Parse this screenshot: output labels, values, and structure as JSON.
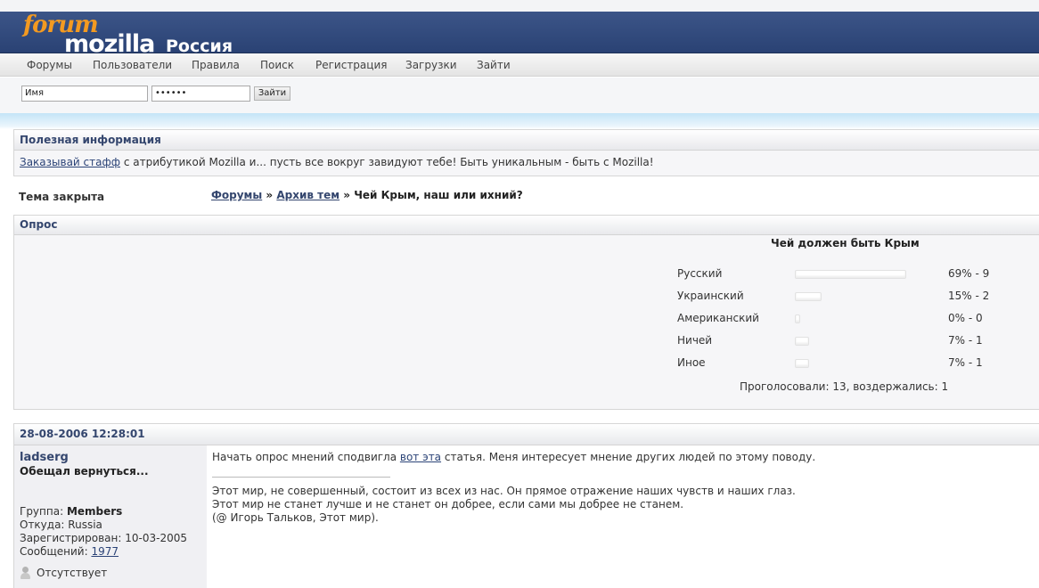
{
  "header": {
    "logo_forum": "forum",
    "logo_mozilla": "mozilla",
    "logo_country": "Россия"
  },
  "nav": {
    "items": [
      "Форумы",
      "Пользователи",
      "Правила",
      "Поиск",
      "Регистрация",
      "Загрузки",
      "Зайти"
    ]
  },
  "login": {
    "username_value": "Имя",
    "password_value": "••••••",
    "submit_label": "Зайти"
  },
  "info_block": {
    "title": "Полезная информация",
    "link_text": "Заказывай стафф",
    "text": " с атрибутикой Mozilla и... пусть все вокруг завидуют тебе! Быть уникальным - быть с Mozilla!"
  },
  "topic": {
    "status": "Тема закрыта",
    "breadcrumb": [
      "Форумы",
      "Архив тем",
      "Чей Крым, наш или ихний?"
    ],
    "separator": "»"
  },
  "poll": {
    "block_title": "Опрос",
    "question": "Чей должен быть Крым",
    "options": [
      {
        "label": "Русский",
        "percent": 69,
        "votes": 9,
        "text": "69% - 9"
      },
      {
        "label": "Украинский",
        "percent": 15,
        "votes": 2,
        "text": "15% - 2"
      },
      {
        "label": "Американский",
        "percent": 0,
        "votes": 0,
        "text": "0% - 0"
      },
      {
        "label": "Ничей",
        "percent": 7,
        "votes": 1,
        "text": "7% - 1"
      },
      {
        "label": "Иное",
        "percent": 7,
        "votes": 1,
        "text": "7% - 1"
      }
    ],
    "total": "Проголосовали: 13, воздержались: 1"
  },
  "post": {
    "date": "28-08-2006 12:28:01",
    "author": "ladserg",
    "author_title": "Обещал вернуться...",
    "group_label": "Группа: ",
    "group_value": "Members",
    "from_label": "Откуда: ",
    "from_value": "Russia",
    "registered_label": "Зарегистрирован: ",
    "registered_value": "10-03-2005",
    "posts_label": "Сообщений: ",
    "posts_value": "1977",
    "status": "Отсутствует",
    "message_before": "Начать опрос мнений сподвигла ",
    "message_link": "вот эта",
    "message_after": " статья. Меня интересует мнение других людей по этому поводу.",
    "signature": [
      "Этот мир, не совершенный, состоит из всех из нас. Он прямое отражение наших чувств и наших глаз.",
      "Этот мир не станет лучше и не станет он добрее, если сами мы добрее не станем.",
      "(@ Игорь Тальков, Этот мир)."
    ]
  }
}
